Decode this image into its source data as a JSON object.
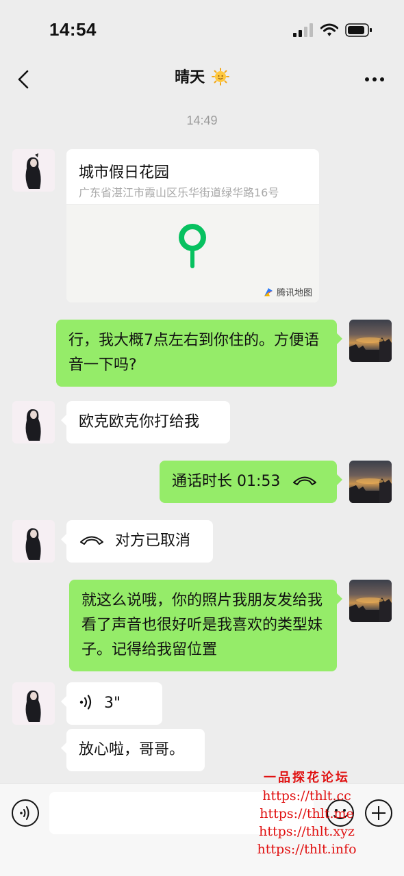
{
  "status_bar": {
    "time": "14:54"
  },
  "nav": {
    "title": "晴天"
  },
  "chat": {
    "timestamp": "14:49",
    "location": {
      "name": "城市假日花园",
      "address": "广东省湛江市霞山区乐华街道绿华路16号",
      "map_brand": "腾讯地图"
    },
    "msg1": "行，我大概7点左右到你住的。方便语音一下吗?",
    "msg2": "欧克欧克你打给我",
    "call_duration": "通话时长 01:53",
    "call_cancelled": "对方已取消",
    "msg3": "就这么说哦，你的照片我朋友发给我看了声音也很好听是我喜欢的类型妹子。记得给我留位置",
    "voice_duration": "3\"",
    "msg4": "放心啦，哥哥。"
  },
  "watermark": {
    "title": "一品探花论坛",
    "links": [
      "https://thlt.cc",
      "https://thlt.me",
      "https://thlt.xyz",
      "https://thlt.info"
    ]
  },
  "colors": {
    "sent_bubble": "#95ec69",
    "received_bubble": "#ffffff",
    "background": "#ededed",
    "pin": "#07c160",
    "watermark": "#e01010"
  }
}
